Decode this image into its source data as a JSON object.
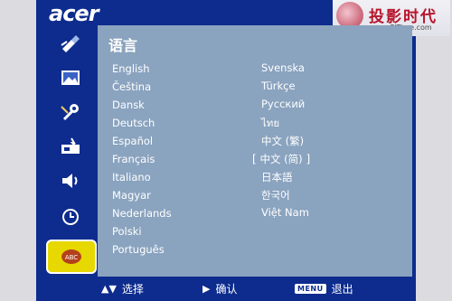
{
  "brand": "acer",
  "watermark": {
    "cn": "投影时代",
    "url": "www.PjTime.com"
  },
  "panel_title": "语言",
  "languages_left": [
    "English",
    "Čeština",
    "Dansk",
    "Deutsch",
    "Español",
    "Français",
    "Italiano",
    "Magyar",
    "Nederlands",
    "Polski",
    "Português"
  ],
  "languages_right": [
    "Svenska",
    "Türkçe",
    "Русский",
    "ไทย",
    "中文 (繁)",
    "中文 (简)",
    "日本語",
    "한국어",
    "Việt Nam"
  ],
  "selected_language": "中文 (简)",
  "sidebar_icons": [
    "color-icon",
    "image-icon",
    "settings-wrench-icon",
    "management-icon",
    "audio-icon",
    "timer-icon",
    "language-abc-icon"
  ],
  "active_sidebar_icon": "language-abc-icon",
  "bottombar": {
    "select_symbol": "▲▼",
    "select_label": "选择",
    "confirm_symbol": "▶",
    "confirm_label": "确认",
    "menu_key": "MENU",
    "exit_label": "退出"
  },
  "colors": {
    "frame": "#0d2c8e",
    "panel": "#8aa3bf",
    "active_item": "#e6d800",
    "watermark_red": "#b7152c"
  }
}
